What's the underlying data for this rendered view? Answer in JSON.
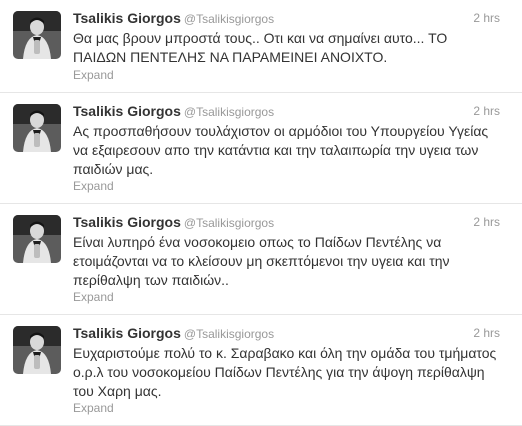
{
  "tweets": [
    {
      "name": "Tsalikis Giorgos",
      "handle": "@Tsalikisgiorgos",
      "time": "2 hrs",
      "text": "Θα μας βρουν μπροστά τους.. Οτι και να σημαίνει αυτο... ΤΟ ΠΑΙΔΩΝ ΠΕΝΤΕΛΗΣ ΝΑ ΠΑΡΑΜΕΙΝΕΙ ΑΝΟΙΧΤΟ.",
      "expand": "Expand"
    },
    {
      "name": "Tsalikis Giorgos",
      "handle": "@Tsalikisgiorgos",
      "time": "2 hrs",
      "text": "Ας προσπαθήσουν τουλάχιστον οι αρμόδιοι του Υπουργείου Υγείας να εξαιρεσουν απο την κατάντια και την ταλαιπωρία την υγεια των παιδιών μας.",
      "expand": "Expand"
    },
    {
      "name": "Tsalikis Giorgos",
      "handle": "@Tsalikisgiorgos",
      "time": "2 hrs",
      "text": "Είναι λυπηρό ένα νοσοκομειο οπως το Παίδων Πεντέλης να ετοιμάζονται να το κλείσουν μη σκεπτόμενοι την υγεια και την περίθαλψη των παιδιών..",
      "expand": "Expand"
    },
    {
      "name": "Tsalikis Giorgos",
      "handle": "@Tsalikisgiorgos",
      "time": "2 hrs",
      "text": "Ευχαριστούμε πολύ το κ. Σαραβακο και όλη την ομάδα του τμήματος ο.ρ.λ του νοσοκομείου Παίδων Πεντέλης για την άψογη περίθαλψη του Χαρη μας.",
      "expand": "Expand"
    }
  ]
}
